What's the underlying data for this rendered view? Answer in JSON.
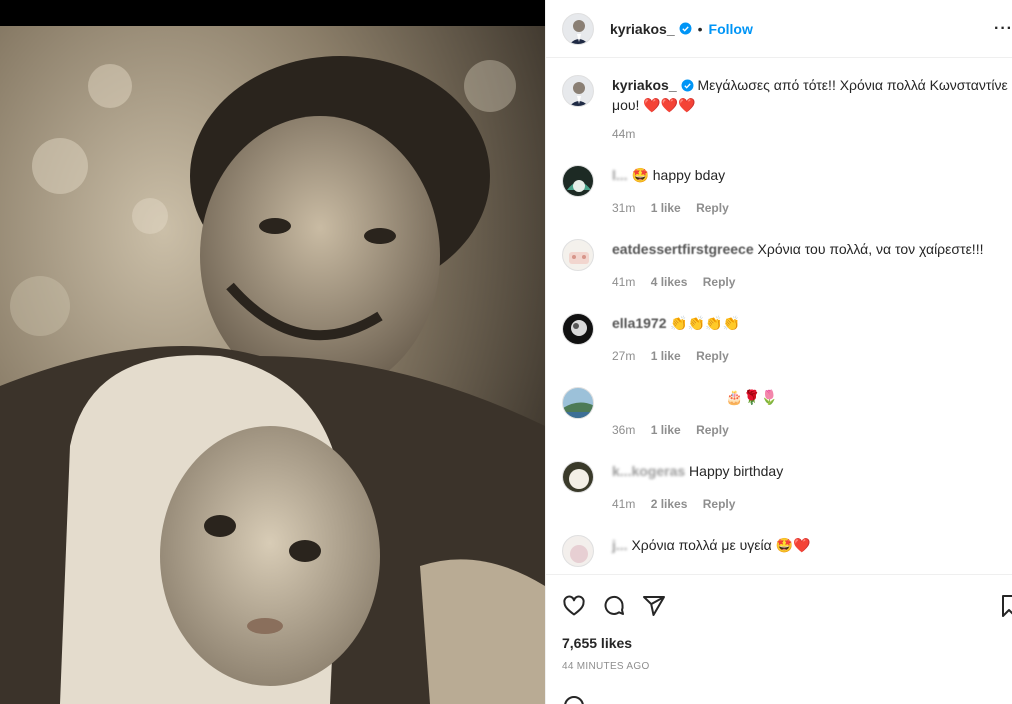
{
  "post": {
    "author": "kyriakos_",
    "follow_label": "Follow",
    "separator": "•",
    "more_label": "···",
    "caption": {
      "author": "kyriakos_",
      "text": "Μεγάλωσες από τότε!! Χρόνια πολλά Κωνσταντίνε μου!",
      "emoji": "❤️❤️❤️",
      "time": "44m"
    },
    "comments": [
      {
        "user": "l...",
        "text": "🤩 happy bday",
        "time": "31m",
        "likes": "1 like",
        "reply": "Reply"
      },
      {
        "user": "eatdessertfirstgreece",
        "text": "Χρόνια του πολλά, να τον χαίρεστε!!!",
        "time": "41m",
        "likes": "4 likes",
        "reply": "Reply"
      },
      {
        "user": "ella1972",
        "text": "👏👏👏👏",
        "time": "27m",
        "likes": "1 like",
        "reply": "Reply"
      },
      {
        "user": "",
        "text": "🎂🌹🌷",
        "time": "36m",
        "likes": "1 like",
        "reply": "Reply"
      },
      {
        "user": "k...kogeras",
        "text": "Happy birthday",
        "time": "41m",
        "likes": "2 likes",
        "reply": "Reply"
      },
      {
        "user": "j...",
        "text": "Χρόνια πολλά με υγεία 🤩❤️",
        "time": "",
        "likes": "",
        "reply": ""
      }
    ],
    "likes": "7,655 likes",
    "time_ago": "44 MINUTES AGO",
    "colors": {
      "accent": "#0095f6",
      "verified": "#0095f6",
      "heart": "#e8132d",
      "muted": "#8e8e8e"
    },
    "icons": [
      "heart-icon",
      "comment-icon",
      "share-icon",
      "bookmark-icon",
      "verified-badge-icon",
      "more-options-icon"
    ]
  }
}
